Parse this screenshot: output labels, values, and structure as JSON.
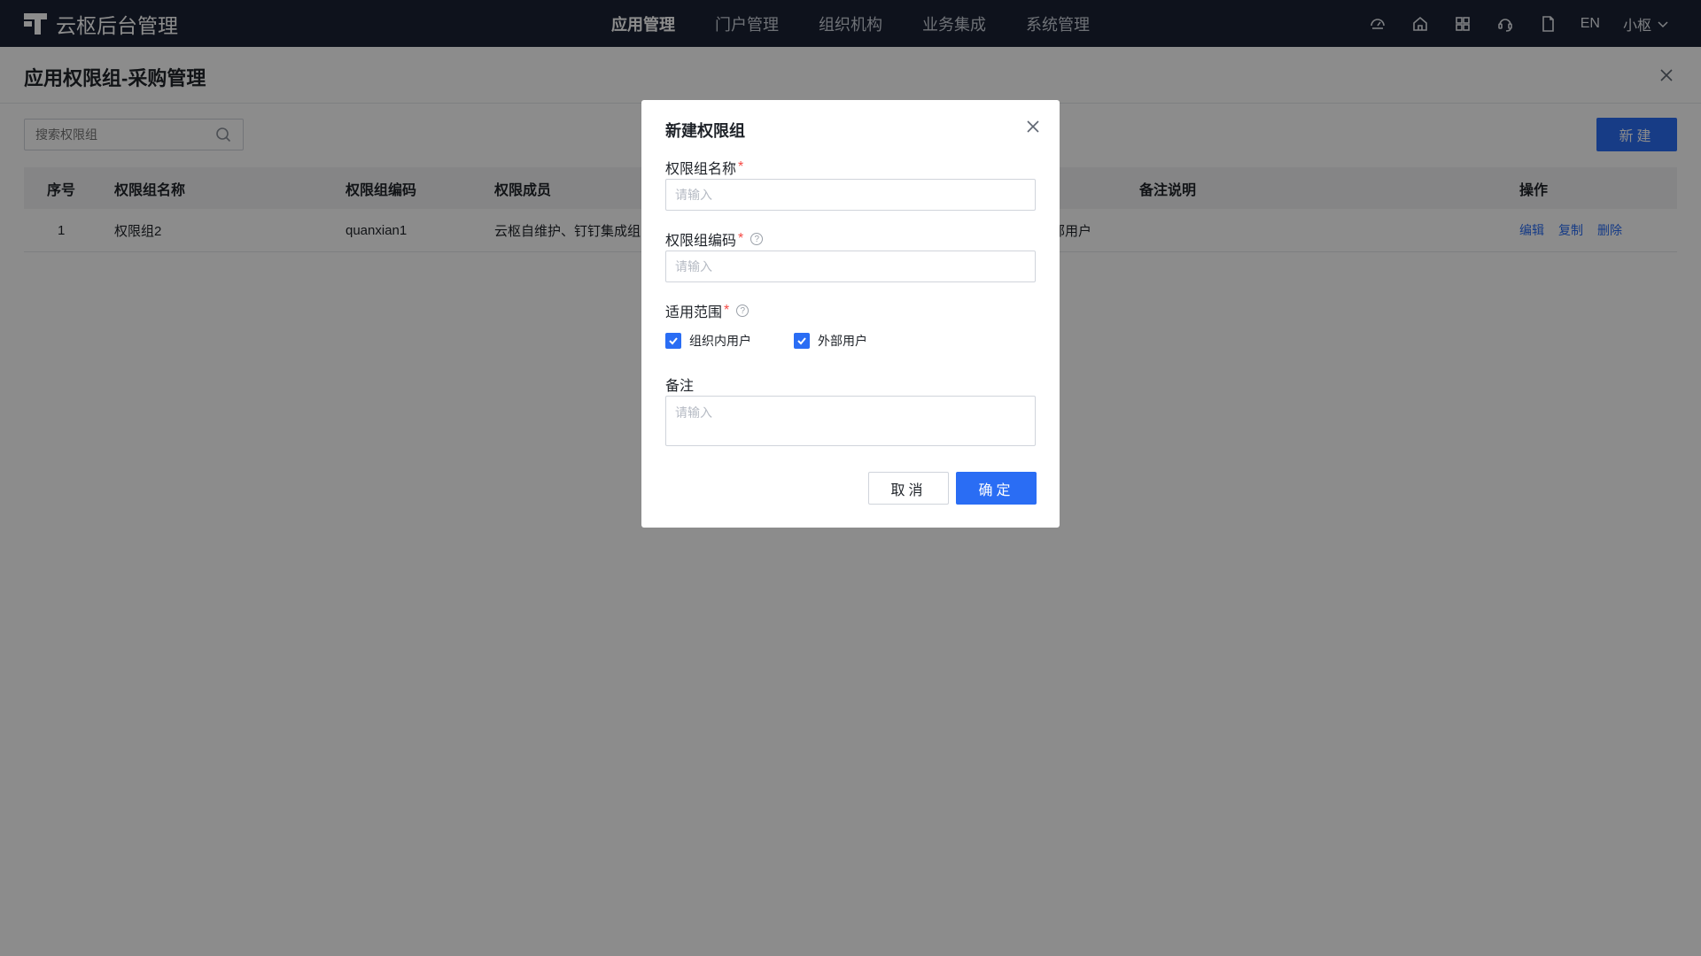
{
  "app": {
    "brand": "云枢后台管理",
    "nav": [
      "应用管理",
      "门户管理",
      "组织机构",
      "业务集成",
      "系统管理"
    ],
    "active_nav": 0,
    "lang": "EN",
    "user": "小枢"
  },
  "page": {
    "title": "应用权限组-采购管理",
    "search_placeholder": "搜索权限组",
    "new_button": "新建"
  },
  "table": {
    "headers": [
      "序号",
      "权限组名称",
      "权限组编码",
      "权限成员",
      "备注说明",
      "操作"
    ],
    "rows": [
      {
        "index": "1",
        "name": "权限组2",
        "code": "quanxian1",
        "members": "云枢自维护、钉钉集成组",
        "members_tail": "部用户",
        "remark": "",
        "actions": [
          "编辑",
          "复制",
          "删除"
        ]
      }
    ]
  },
  "modal": {
    "title": "新建权限组",
    "name_label": "权限组名称",
    "name_placeholder": "请输入",
    "code_label": "权限组编码",
    "code_placeholder": "请输入",
    "scope_label": "适用范围",
    "scope_options": [
      "组织内用户",
      "外部用户"
    ],
    "scope_checked": [
      true,
      true
    ],
    "remark_label": "备注",
    "remark_placeholder": "请输入",
    "cancel": "取消",
    "confirm": "确定"
  },
  "colors": {
    "primary": "#2a6df4",
    "topbar": "#1a2233",
    "required": "#f54a45"
  }
}
